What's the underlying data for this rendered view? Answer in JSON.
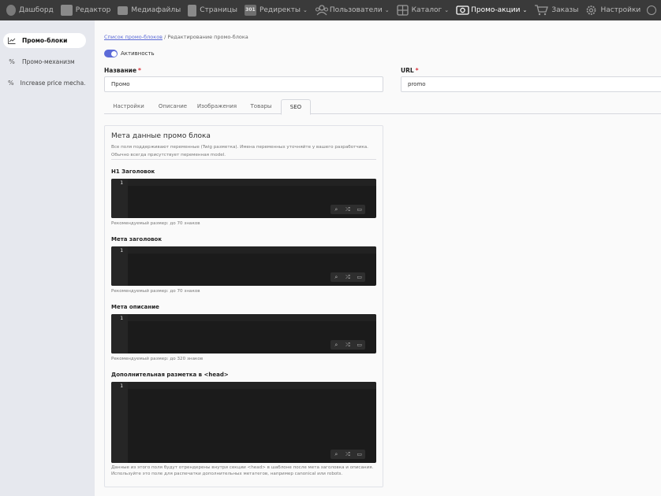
{
  "topnav": {
    "items": [
      {
        "label": "Дашборд",
        "icon": "leaf-icon",
        "chevron": false,
        "active": false
      },
      {
        "label": "Редактор",
        "icon": "image-editor-icon",
        "chevron": false,
        "active": false
      },
      {
        "label": "Медиафайлы",
        "icon": "media-icon",
        "chevron": false,
        "active": false
      },
      {
        "label": "Страницы",
        "icon": "pages-icon",
        "chevron": false,
        "active": false
      },
      {
        "label": "Редиректы",
        "icon": "redirect-301-icon",
        "icon_text": "301",
        "chevron": true,
        "active": false
      },
      {
        "label": "Пользователи",
        "icon": "users-icon",
        "chevron": true,
        "active": false
      },
      {
        "label": "Каталог",
        "icon": "catalog-icon",
        "chevron": true,
        "active": false
      },
      {
        "label": "Промо-акции",
        "icon": "promo-icon",
        "chevron": true,
        "active": true
      },
      {
        "label": "Заказы",
        "icon": "cart-icon",
        "chevron": false,
        "active": false
      },
      {
        "label": "Настройки",
        "icon": "gear-icon",
        "chevron": false,
        "active": false
      }
    ],
    "chevron_glyph": "⌄"
  },
  "sidebar": {
    "items": [
      {
        "label": "Промо-блоки",
        "icon": "chart-line-icon",
        "glyph": "⟋",
        "active": true
      },
      {
        "label": "Промо-механизм",
        "icon": "percent-icon",
        "glyph": "%",
        "active": false
      },
      {
        "label": "Increase price mecha...",
        "icon": "percent-icon",
        "glyph": "%",
        "active": false
      }
    ]
  },
  "breadcrumb": {
    "link": "Список промо-блоков",
    "separator": " / ",
    "current": "Редактирование промо-блока"
  },
  "activity": {
    "label": "Активность",
    "on": true
  },
  "form": {
    "name_label": "Название",
    "name_value": "Промо",
    "url_label": "URL",
    "url_value": "promo",
    "required_mark": "*"
  },
  "tabs": [
    "Настройки",
    "Описание",
    "Изображения",
    "Товары",
    "SEO"
  ],
  "active_tab": "SEO",
  "seo": {
    "title": "Мета данные промо блока",
    "desc_line1": "Все поля поддерживают переменные (Twig разметка). Имена переменных уточняйте у вашего разработчика.",
    "desc_line2": "Обычно всегда присутствует переменная model.",
    "fields": [
      {
        "label": "H1 Заголовок",
        "line_no": "1",
        "hint": "Рекомендуемый размер: до 70 знаков"
      },
      {
        "label": "Мета заголовок",
        "line_no": "1",
        "hint": "Рекомендуемый размер: до 70 знаков"
      },
      {
        "label": "Мета описание",
        "line_no": "1",
        "hint": "Рекомендуемый размер: до 320 знаков"
      },
      {
        "label": "Дополнительная разметка в <head>",
        "line_no": "1",
        "hint_line1": "Данные из этого поля будут отрендерены внутри секции <head> в шаблоне после мета заголовка и описания.",
        "hint_line2": "Используйте это поле для распечатки дополнительных метатегов, например canonical или robots."
      }
    ],
    "tools": [
      {
        "icon": "search-icon",
        "glyph": "⌕"
      },
      {
        "icon": "shuffle-icon",
        "glyph": "⤮"
      },
      {
        "icon": "fullscreen-icon",
        "glyph": "▭"
      }
    ]
  },
  "colors": {
    "accent": "#5c6bd8",
    "topbar": "#3a3a3a",
    "editor_bg": "#1b1b1b"
  }
}
